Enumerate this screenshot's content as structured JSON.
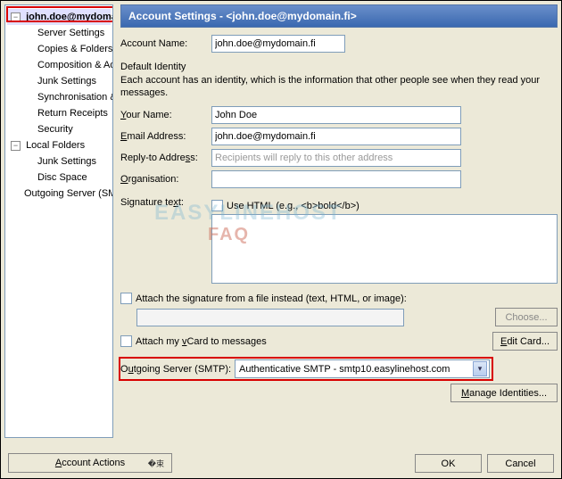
{
  "sidebar": {
    "account_email": "john.doe@mydomain.fi",
    "items": [
      "Server Settings",
      "Copies & Folders",
      "Composition & Addressing",
      "Junk Settings",
      "Synchronisation & Storage",
      "Return Receipts",
      "Security"
    ],
    "local_folders_label": "Local Folders",
    "local_items": [
      "Junk Settings",
      "Disc Space"
    ],
    "outgoing_label": "Outgoing Server (SMTP)",
    "account_actions_label": "Account Actions"
  },
  "panel": {
    "title": "Account Settings - <john.doe@mydomain.fi>",
    "account_name_label": "Account Name:",
    "account_name_value": "john.doe@mydomain.fi",
    "default_identity_label": "Default Identity",
    "identity_hint": "Each account has an identity, which is the information that other people see when they read your messages.",
    "your_name_label": "Your Name:",
    "your_name_value": "John Doe",
    "email_label": "Email Address:",
    "email_value": "john.doe@mydomain.fi",
    "reply_to_label": "Reply-to Address:",
    "reply_to_placeholder": "Recipients will reply to this other address",
    "organisation_label": "Organisation:",
    "organisation_value": "",
    "signature_label": "Signature text:",
    "use_html_label": "Use HTML (e.g., <b>bold</b>)",
    "attach_sig_label": "Attach the signature from a file instead (text, HTML, or image):",
    "attach_sig_path": "",
    "choose_label": "Choose...",
    "attach_vcard_label": "Attach my vCard to messages",
    "edit_card_label": "Edit Card...",
    "outgoing_label": "Outgoing Server (SMTP):",
    "outgoing_value": "Authenticative SMTP - smtp10.easylinehost.com",
    "manage_identities_label": "Manage Identities..."
  },
  "buttons": {
    "ok": "OK",
    "cancel": "Cancel"
  },
  "watermark": {
    "line1": "EASYLINEHOST",
    "line2": "FAQ"
  }
}
